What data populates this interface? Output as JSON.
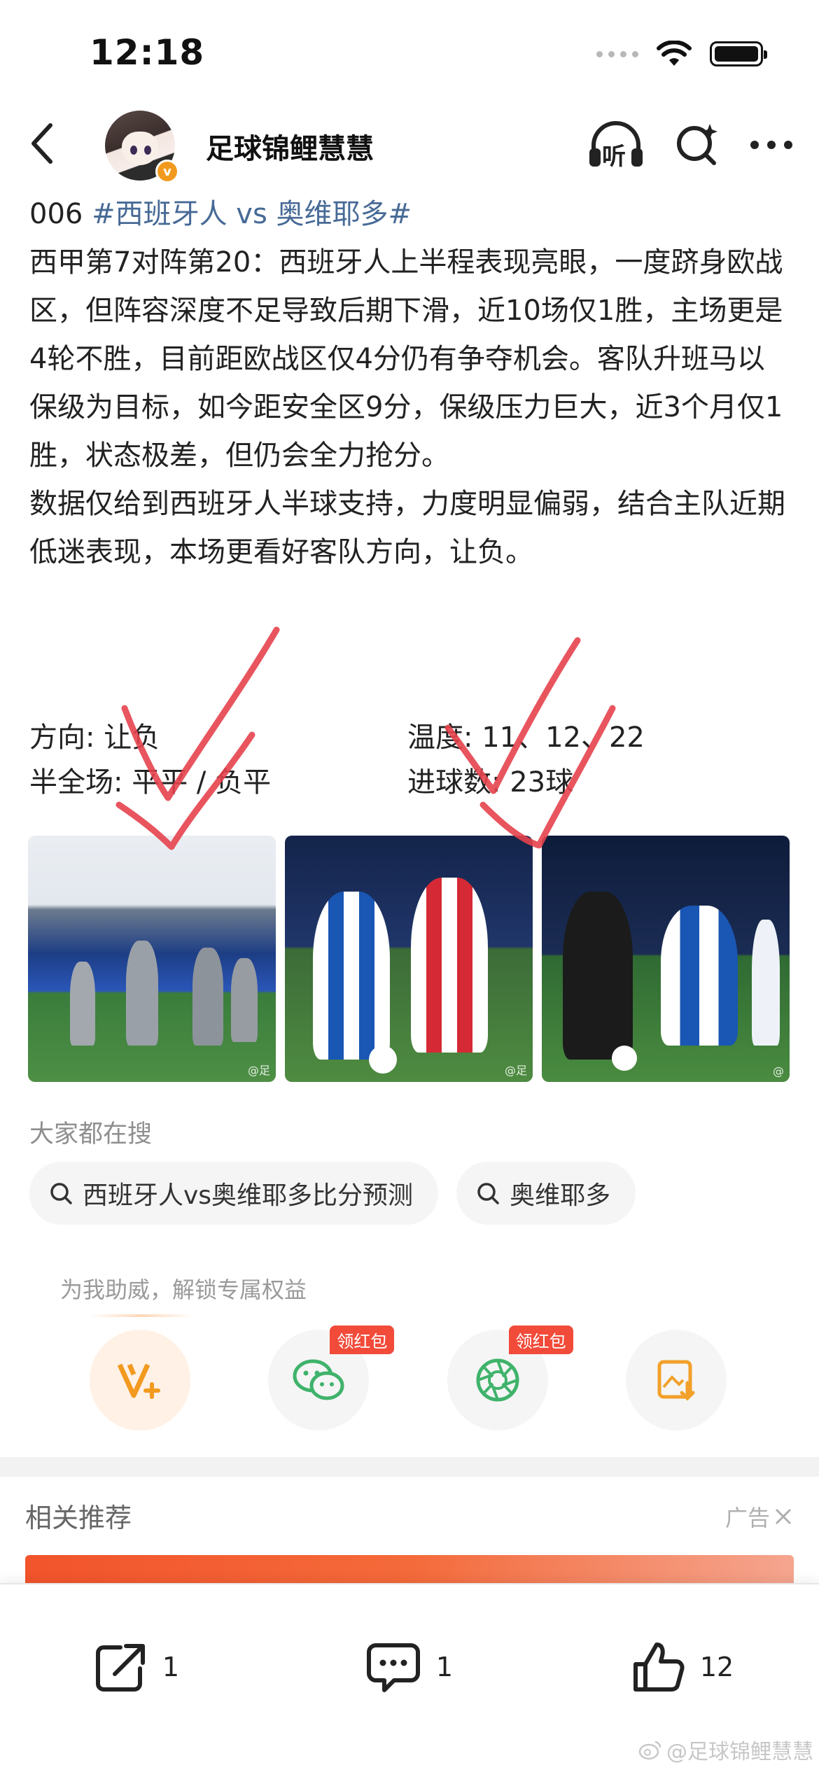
{
  "status_bar": {
    "time": "12:18"
  },
  "header": {
    "account_name": "足球锦鲤慧慧",
    "verified_badge": "v",
    "listen_label": "听"
  },
  "post": {
    "number_prefix": "006 ",
    "hashtag": "#西班牙人 vs 奥维耶多#",
    "paragraph1": "西甲第7对阵第20：西班牙人上半程表现亮眼，一度跻身欧战区，但阵容深度不足导致后期下滑，近10场仅1胜，主场更是4轮不胜，目前距欧战区仅4分仍有争夺机会。客队升班马以保级为目标，如今距安全区9分，保级压力巨大，近3个月仅1胜，状态极差，但仍会全力抢分。",
    "paragraph2": "数据仅给到西班牙人半球支持，力度明显偏弱，结合主队近期低迷表现，本场更看好客队方向，让负。",
    "direction": "方向: 让负",
    "temperature": "温度: 11、12、22",
    "half_full": "半全场: 平平 / 负平",
    "goals": "进球数: 23球"
  },
  "images": [
    {
      "watermark": "@足"
    },
    {
      "watermark": "@足"
    },
    {
      "watermark": "@"
    }
  ],
  "search": {
    "title": "大家都在搜",
    "chips": [
      "西班牙人vs奥维耶多比分预测",
      "奥维耶多"
    ]
  },
  "support": {
    "title": "为我助威，解锁专属权益",
    "red_packet_badge": "领红包"
  },
  "related": {
    "title": "相关推荐",
    "ad_label": "广告"
  },
  "bottom_bar": {
    "share_count": "1",
    "comment_count": "1",
    "like_count": "12"
  },
  "watermark_text": "@足球锦鲤慧慧",
  "colors": {
    "hashtag": "#476a96",
    "accent_orange": "#f29a1f",
    "red_badge": "#f24b3a",
    "check_mark": "#e5424d"
  }
}
